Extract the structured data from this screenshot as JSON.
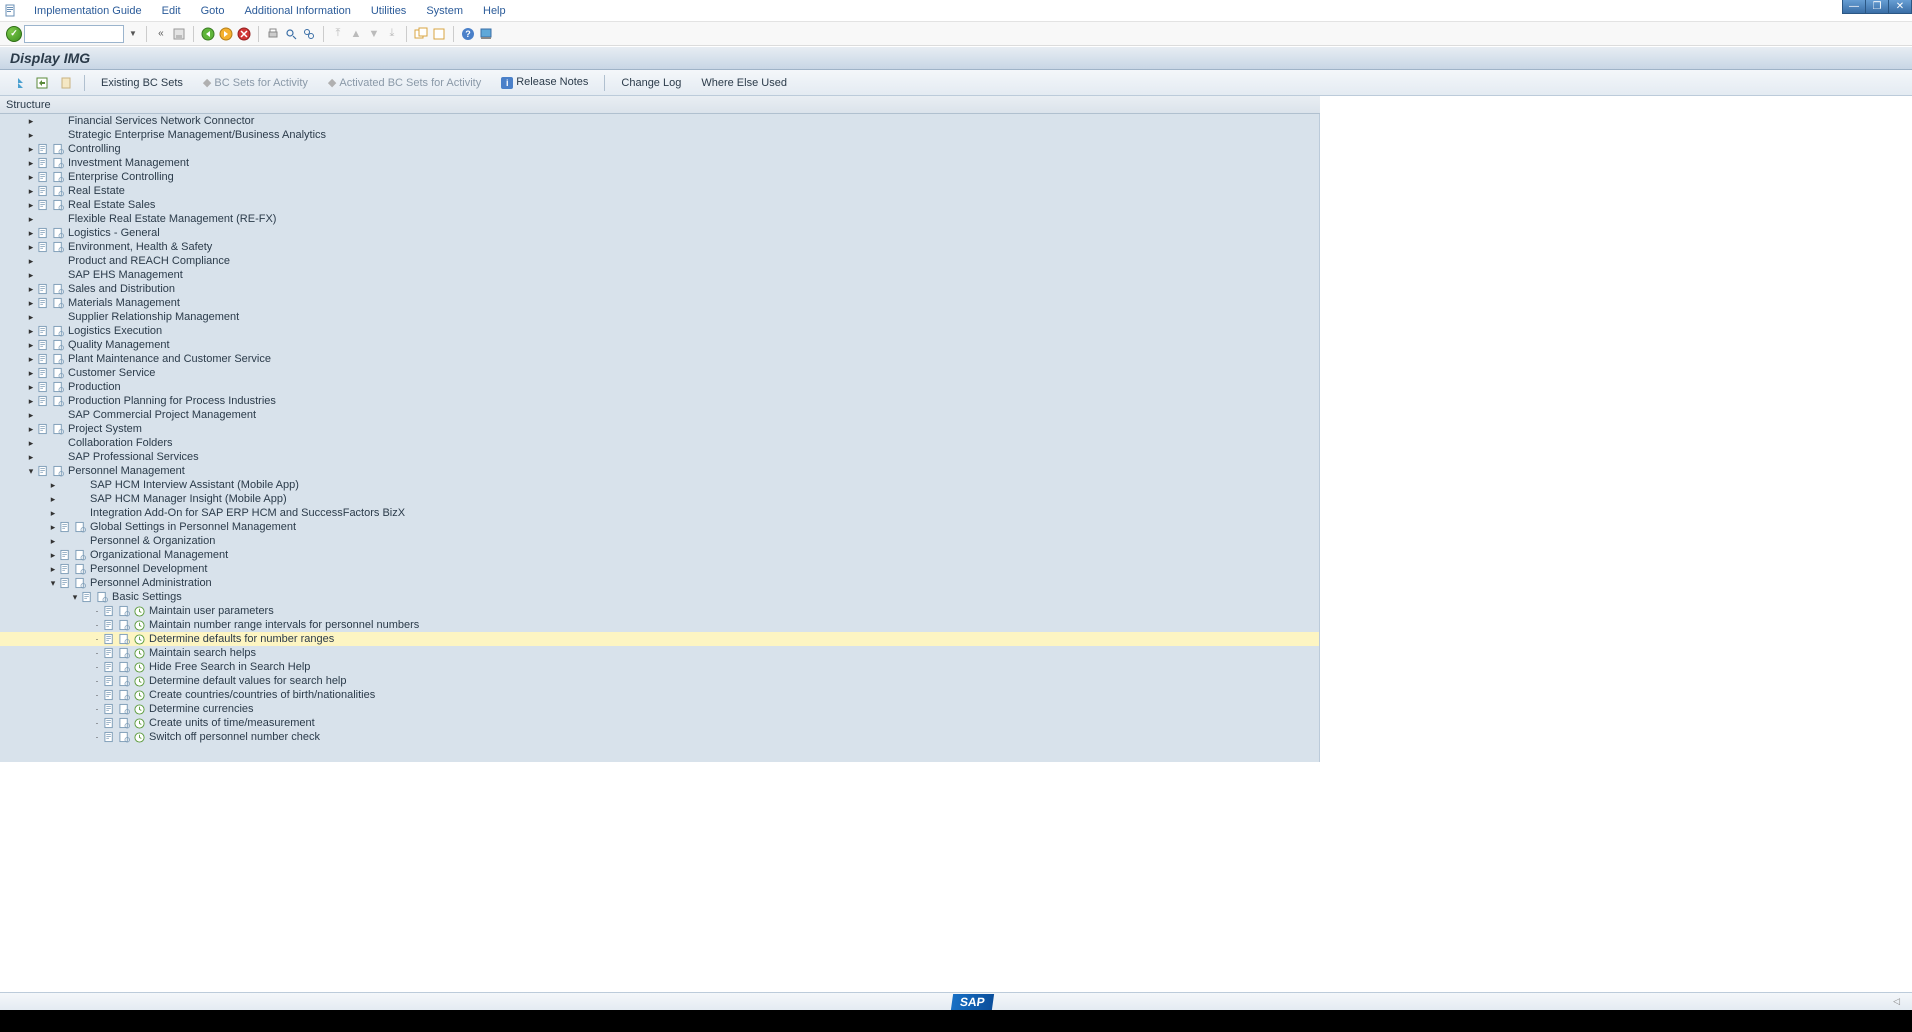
{
  "menu": {
    "items": [
      "Implementation Guide",
      "Edit",
      "Goto",
      "Additional Information",
      "Utilities",
      "System",
      "Help"
    ]
  },
  "title": "Display IMG",
  "apptoolbar": {
    "existing": "Existing BC Sets",
    "bc_activity": "BC Sets for Activity",
    "bc_activated": "Activated BC Sets for Activity",
    "release_notes": "Release Notes",
    "change_log": "Change Log",
    "where_used": "Where Else Used"
  },
  "tree_header": "Structure",
  "tree": [
    {
      "d": 0,
      "e": "c",
      "i": [
        "",
        ""
      ],
      "t": "Financial Services Network Connector"
    },
    {
      "d": 0,
      "e": "c",
      "i": [
        "",
        ""
      ],
      "t": "Strategic Enterprise Management/Business Analytics"
    },
    {
      "d": 0,
      "e": "c",
      "i": [
        "d",
        "a"
      ],
      "t": "Controlling"
    },
    {
      "d": 0,
      "e": "c",
      "i": [
        "d",
        "a"
      ],
      "t": "Investment Management"
    },
    {
      "d": 0,
      "e": "c",
      "i": [
        "d",
        "a"
      ],
      "t": "Enterprise Controlling"
    },
    {
      "d": 0,
      "e": "c",
      "i": [
        "d",
        "a"
      ],
      "t": "Real Estate"
    },
    {
      "d": 0,
      "e": "c",
      "i": [
        "d",
        "a"
      ],
      "t": "Real Estate Sales"
    },
    {
      "d": 0,
      "e": "c",
      "i": [
        "",
        ""
      ],
      "t": "Flexible Real Estate Management (RE-FX)"
    },
    {
      "d": 0,
      "e": "c",
      "i": [
        "d",
        "a"
      ],
      "t": "Logistics - General"
    },
    {
      "d": 0,
      "e": "c",
      "i": [
        "d",
        "a"
      ],
      "t": "Environment, Health & Safety"
    },
    {
      "d": 0,
      "e": "c",
      "i": [
        "",
        ""
      ],
      "t": "Product and REACH Compliance"
    },
    {
      "d": 0,
      "e": "c",
      "i": [
        "",
        ""
      ],
      "t": "SAP EHS Management"
    },
    {
      "d": 0,
      "e": "c",
      "i": [
        "d",
        "a"
      ],
      "t": "Sales and Distribution"
    },
    {
      "d": 0,
      "e": "c",
      "i": [
        "d",
        "a"
      ],
      "t": "Materials Management"
    },
    {
      "d": 0,
      "e": "c",
      "i": [
        "",
        ""
      ],
      "t": "Supplier Relationship Management"
    },
    {
      "d": 0,
      "e": "c",
      "i": [
        "d",
        "a"
      ],
      "t": "Logistics Execution"
    },
    {
      "d": 0,
      "e": "c",
      "i": [
        "d",
        "a"
      ],
      "t": "Quality Management"
    },
    {
      "d": 0,
      "e": "c",
      "i": [
        "d",
        "a"
      ],
      "t": "Plant Maintenance and Customer Service"
    },
    {
      "d": 0,
      "e": "c",
      "i": [
        "d",
        "a"
      ],
      "t": "Customer Service"
    },
    {
      "d": 0,
      "e": "c",
      "i": [
        "d",
        "a"
      ],
      "t": "Production"
    },
    {
      "d": 0,
      "e": "c",
      "i": [
        "d",
        "a"
      ],
      "t": "Production Planning for Process Industries"
    },
    {
      "d": 0,
      "e": "c",
      "i": [
        "",
        ""
      ],
      "t": "SAP Commercial Project Management"
    },
    {
      "d": 0,
      "e": "c",
      "i": [
        "d",
        "a"
      ],
      "t": "Project System"
    },
    {
      "d": 0,
      "e": "c",
      "i": [
        "",
        ""
      ],
      "t": "Collaboration Folders"
    },
    {
      "d": 0,
      "e": "c",
      "i": [
        "",
        ""
      ],
      "t": "SAP Professional Services"
    },
    {
      "d": 0,
      "e": "o",
      "i": [
        "d",
        "a"
      ],
      "t": "Personnel Management"
    },
    {
      "d": 1,
      "e": "c",
      "i": [
        "",
        ""
      ],
      "t": "SAP HCM Interview Assistant (Mobile App)"
    },
    {
      "d": 1,
      "e": "c",
      "i": [
        "",
        ""
      ],
      "t": "SAP HCM Manager Insight (Mobile App)"
    },
    {
      "d": 1,
      "e": "c",
      "i": [
        "",
        ""
      ],
      "t": "Integration Add-On for SAP ERP HCM and SuccessFactors BizX"
    },
    {
      "d": 1,
      "e": "c",
      "i": [
        "d",
        "a"
      ],
      "t": "Global Settings in Personnel Management"
    },
    {
      "d": 1,
      "e": "c",
      "i": [
        "",
        ""
      ],
      "t": "Personnel & Organization"
    },
    {
      "d": 1,
      "e": "c",
      "i": [
        "d",
        "a"
      ],
      "t": "Organizational Management"
    },
    {
      "d": 1,
      "e": "c",
      "i": [
        "d",
        "a"
      ],
      "t": "Personnel Development"
    },
    {
      "d": 1,
      "e": "o",
      "i": [
        "d",
        "a"
      ],
      "t": "Personnel Administration"
    },
    {
      "d": 2,
      "e": "o",
      "i": [
        "d",
        "a"
      ],
      "t": "Basic Settings"
    },
    {
      "d": 3,
      "e": "l",
      "i": [
        "d",
        "a",
        "x"
      ],
      "t": "Maintain user parameters"
    },
    {
      "d": 3,
      "e": "l",
      "i": [
        "d",
        "a",
        "x"
      ],
      "t": "Maintain number range intervals for personnel numbers"
    },
    {
      "d": 3,
      "e": "l",
      "i": [
        "d",
        "a",
        "x"
      ],
      "t": "Determine defaults for number ranges",
      "hl": true
    },
    {
      "d": 3,
      "e": "l",
      "i": [
        "d",
        "a",
        "x"
      ],
      "t": "Maintain search helps"
    },
    {
      "d": 3,
      "e": "l",
      "i": [
        "d",
        "a",
        "x"
      ],
      "t": "Hide Free Search in Search Help"
    },
    {
      "d": 3,
      "e": "l",
      "i": [
        "d",
        "a",
        "x"
      ],
      "t": "Determine default values for search help"
    },
    {
      "d": 3,
      "e": "l",
      "i": [
        "d",
        "a",
        "x"
      ],
      "t": "Create countries/countries of birth/nationalities"
    },
    {
      "d": 3,
      "e": "l",
      "i": [
        "d",
        "a",
        "x"
      ],
      "t": "Determine currencies"
    },
    {
      "d": 3,
      "e": "l",
      "i": [
        "d",
        "a",
        "x"
      ],
      "t": "Create units of time/measurement"
    },
    {
      "d": 3,
      "e": "l",
      "i": [
        "d",
        "a",
        "x"
      ],
      "t": "Switch off personnel number check"
    }
  ],
  "footer": {
    "logo": "SAP"
  }
}
